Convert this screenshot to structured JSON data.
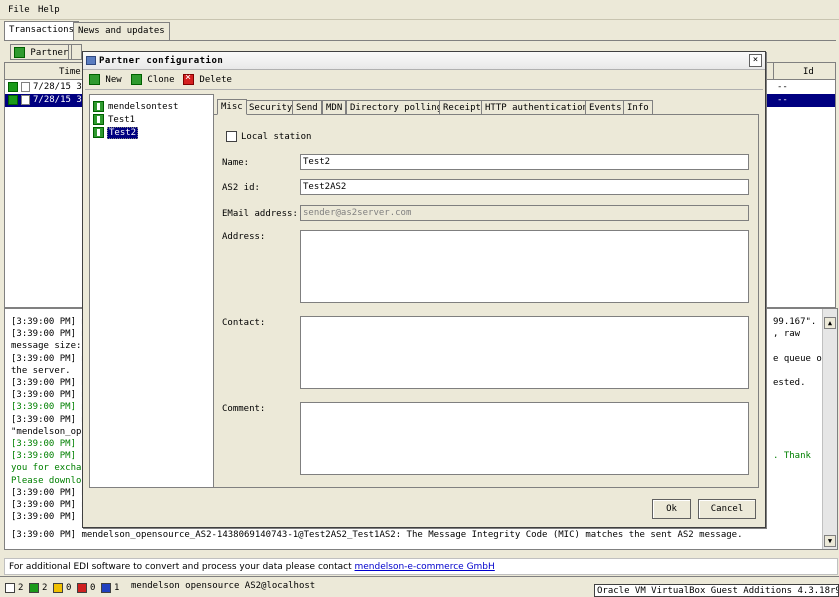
{
  "menubar": {
    "file": "File",
    "help": "Help"
  },
  "main_tabs": [
    "Transactions",
    "News and updates"
  ],
  "toolbar": {
    "partner": "Partner"
  },
  "grid": {
    "col_time": "Time",
    "col_id": "Id",
    "rows": [
      {
        "time": "7/28/15 3",
        "id": "--"
      },
      {
        "time": "7/28/15 3",
        "id": "--"
      }
    ]
  },
  "log": {
    "lines": [
      {
        "left": "[3:39:00 PM] m",
        "right": "99.167\".",
        "green": false
      },
      {
        "left": "[3:39:00 PM] m",
        "right": ", raw",
        "green": false
      },
      {
        "left": "message size:",
        "right": "",
        "green": false
      },
      {
        "left": "[3:39:00 PM] m",
        "right": "e queue of",
        "green": false
      },
      {
        "left": "the server.",
        "right": "",
        "green": false
      },
      {
        "left": "[3:39:00 PM] m",
        "right": "ested.",
        "green": false
      },
      {
        "left": "[3:39:00 PM] m",
        "right": "",
        "green": false
      },
      {
        "left": "[3:39:00 PM] m",
        "right": "",
        "green": true
      },
      {
        "left": "[3:39:00 PM] m",
        "right": "",
        "green": false
      },
      {
        "left": "\"mendelson_ope",
        "right": "",
        "green": false
      },
      {
        "left": "[3:39:00 PM] m",
        "right": "",
        "green": true
      },
      {
        "left": "[3:39:00 PM] m",
        "right": ". Thank",
        "green": true
      },
      {
        "left": "you for exchan",
        "right": "",
        "green": true
      },
      {
        "left": "Please downloa",
        "right": "",
        "green": true
      },
      {
        "left": "[3:39:00 PM] m",
        "right": "",
        "green": false
      },
      {
        "left": "[3:39:00 PM] m",
        "right": "",
        "green": false
      },
      {
        "left": "[3:39:00 PM] m",
        "right": "",
        "green": false
      }
    ],
    "last_line": "[3:39:00 PM] mendelson_opensource_AS2-1438069140743-1@Test2AS2_Test1AS2: The Message Integrity Code (MIC) matches the sent AS2 message."
  },
  "info": {
    "text": "For additional EDI software to convert and process your data please contact ",
    "link": "mendelson-e-commerce GmbH"
  },
  "status": {
    "counts": [
      "2",
      "2",
      "0",
      "0",
      "1"
    ],
    "colors": [
      "#ffffff",
      "#1a9a1a",
      "#f0c000",
      "#d02020",
      "#2040c0"
    ],
    "user": "mendelson opensource AS2@localhost",
    "vbox": "Oracle VM VirtualBox Guest Additions 4.3.18r96516"
  },
  "dialog": {
    "title": "Partner configuration",
    "close": "×",
    "toolbar": {
      "new": "New",
      "clone": "Clone",
      "delete": "Delete"
    },
    "partners": [
      {
        "name": "mendelsontest",
        "selected": false
      },
      {
        "name": "Test1",
        "selected": false
      },
      {
        "name": "Test2",
        "selected": true
      }
    ],
    "tabs": [
      "Misc",
      "Security",
      "Send",
      "MDN",
      "Directory polling",
      "Receipt",
      "HTTP authentication",
      "Events",
      "Info"
    ],
    "misc": {
      "local_station": "Local station",
      "name_label": "Name:",
      "name_value": "Test2",
      "as2id_label": "AS2 id:",
      "as2id_value": "Test2AS2",
      "email_label": "EMail address:",
      "email_value": "sender@as2server.com",
      "address_label": "Address:",
      "contact_label": "Contact:",
      "comment_label": "Comment:"
    },
    "ok": "Ok",
    "cancel": "Cancel"
  }
}
